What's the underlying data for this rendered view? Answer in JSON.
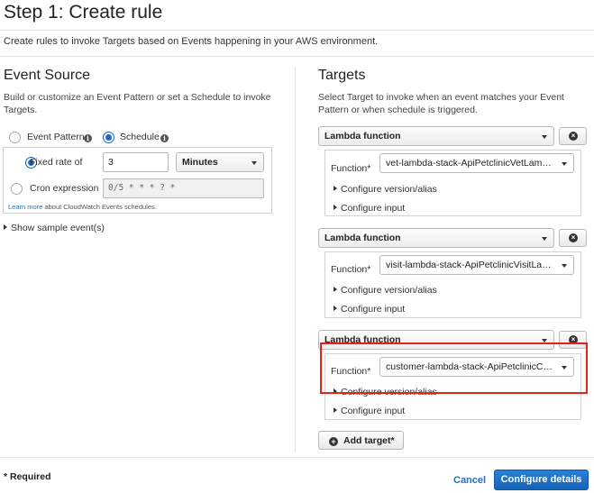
{
  "page": {
    "title": "Step 1: Create rule",
    "subtitle": "Create rules to invoke Targets based on Events happening in your AWS environment."
  },
  "event_source": {
    "title": "Event Source",
    "description": "Build or customize an Event Pattern or set a Schedule to invoke Targets.",
    "mode_options": [
      {
        "label": "Event Pattern",
        "selected": false
      },
      {
        "label": "Schedule",
        "selected": true
      }
    ],
    "fixed_rate": {
      "label": "Fixed rate of",
      "value": "3",
      "unit": "Minutes",
      "selected": true
    },
    "cron": {
      "label": "Cron expression",
      "placeholder": "0/5 * * * ? *",
      "selected": false
    },
    "learn_more_link": "Learn more",
    "learn_more_text": "about CloudWatch Events schedules.",
    "show_sample": "Show sample event(s)"
  },
  "targets": {
    "title": "Targets",
    "description": "Select Target to invoke when an event matches your Event Pattern or when schedule is triggered.",
    "function_label": "Function*",
    "items": [
      {
        "type": "Lambda function",
        "function": "vet-lambda-stack-ApiPetclinicVetLambda...",
        "configure_version": "Configure version/alias",
        "configure_input": "Configure input"
      },
      {
        "type": "Lambda function",
        "function": "visit-lambda-stack-ApiPetclinicVisitLamb...",
        "configure_version": "Configure version/alias",
        "configure_input": "Configure input"
      },
      {
        "type": "Lambda function",
        "function": "customer-lambda-stack-ApiPetclinicCus...",
        "configure_version": "Configure version/alias",
        "configure_input": "Configure input"
      }
    ],
    "add_target": "Add target*"
  },
  "footer": {
    "required_note": "* Required",
    "cancel": "Cancel",
    "configure_details": "Configure details"
  },
  "colors": {
    "accent": "#1f6fbf",
    "primary_button": "#1a6dc4",
    "highlight": "#e2231a"
  }
}
